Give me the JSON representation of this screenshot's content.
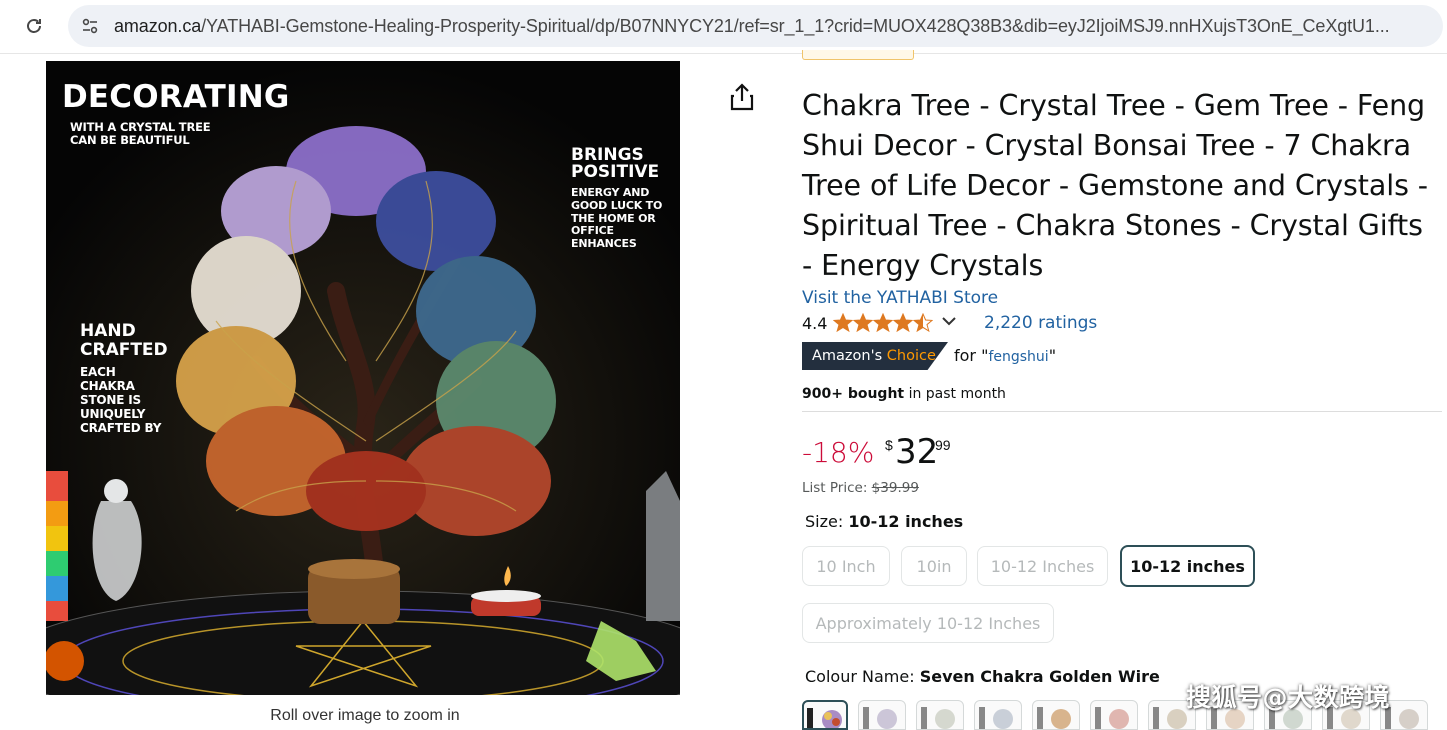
{
  "browser": {
    "url_domain": "amazon.ca",
    "url_path": "/YATHABI-Gemstone-Healing-Prosperity-Spiritual/dp/B07NNYCY21/ref=sr_1_1?crid=MUOX428Q38B3&dib=eyJ2IjoiMSJ9.nnHXujsT3OnE_CeXgtU1..."
  },
  "image": {
    "headline": "DECORATING",
    "headline_sub": [
      "WITH A CRYSTAL TREE",
      "CAN BE BEAUTIFUL"
    ],
    "right_title": [
      "BRINGS",
      "POSITIVE"
    ],
    "right_body": [
      "ENERGY AND",
      "GOOD LUCK TO",
      "THE HOME OR",
      "OFFICE",
      "ENHANCES"
    ],
    "left_title": [
      "HAND",
      "CRAFTED"
    ],
    "left_body": [
      "EACH",
      "CHAKRA",
      "STONE IS",
      "UNIQUELY",
      "CRAFTED BY"
    ],
    "zoom_hint": "Roll over image to zoom in"
  },
  "product": {
    "title": "Chakra Tree - Crystal Tree - Gem Tree - Feng Shui Decor - Crystal Bonsai Tree - 7 Chakra Tree of Life Decor - Gemstone and Crystals - Spiritual Tree - Chakra Stones - Crystal Gifts - Energy Crystals",
    "store_link": "Visit the YATHABI Store",
    "rating_value": "4.4",
    "rating_fraction": 0.88,
    "ratings_count": "2,220 ratings",
    "badge_prefix": "Amazon's",
    "badge_choice": "Choice",
    "badge_for": "for \"",
    "badge_keyword": "fengshui",
    "badge_close": "\"",
    "bought_bold": "900+ bought",
    "bought_rest": " in past month",
    "discount": "-18%",
    "currency": "$",
    "price_whole": "32",
    "price_fraction": "99",
    "list_price_label": "List Price: ",
    "list_price": "$39.99",
    "size_label": "Size: ",
    "size_selected": "10-12 inches",
    "size_options": [
      "10 Inch",
      "10in",
      "10-12 Inches",
      "10-12 inches",
      "Approximately 10-12 Inches"
    ],
    "colour_label": "Colour Name: ",
    "colour_selected": "Seven Chakra Golden Wire"
  },
  "watermark": "搜狐号@大数跨境",
  "colors": {
    "link": "#2162a1",
    "deal_red": "#cc0c39",
    "badge_bg": "#232f3e",
    "badge_orange": "#ff9900",
    "star": "#de7921"
  }
}
